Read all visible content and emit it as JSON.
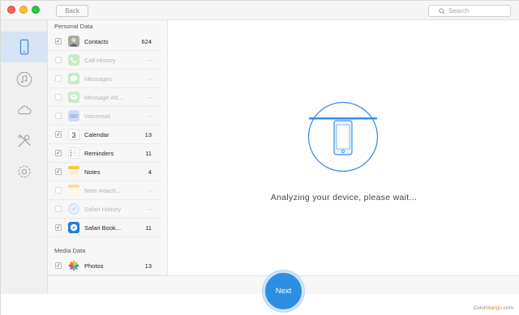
{
  "titlebar": {
    "back_label": "Back",
    "search_placeholder": "Search"
  },
  "sidebar": {
    "items": [
      {
        "icon": "phone-icon",
        "active": true
      },
      {
        "icon": "music-icon",
        "active": false
      },
      {
        "icon": "cloud-icon",
        "active": false
      },
      {
        "icon": "tools-icon",
        "active": false
      },
      {
        "icon": "gear-icon",
        "active": false
      }
    ]
  },
  "categories": {
    "personal_label": "Personal Data",
    "media_label": "Media Data",
    "items": [
      {
        "name": "Contacts",
        "count": "624",
        "checked": true,
        "enabled": true,
        "icon": "contacts-icon"
      },
      {
        "name": "Call History",
        "count": "--",
        "checked": false,
        "enabled": false,
        "icon": "phone-call-icon"
      },
      {
        "name": "Messages",
        "count": "--",
        "checked": false,
        "enabled": false,
        "icon": "messages-icon"
      },
      {
        "name": "Message Att...",
        "count": "--",
        "checked": false,
        "enabled": false,
        "icon": "message-attachment-icon"
      },
      {
        "name": "Voicemail",
        "count": "--",
        "checked": false,
        "enabled": false,
        "icon": "voicemail-icon"
      },
      {
        "name": "Calendar",
        "count": "13",
        "checked": true,
        "enabled": true,
        "icon": "calendar-icon"
      },
      {
        "name": "Reminders",
        "count": "11",
        "checked": true,
        "enabled": true,
        "icon": "reminders-icon"
      },
      {
        "name": "Notes",
        "count": "4",
        "checked": true,
        "enabled": true,
        "icon": "notes-icon"
      },
      {
        "name": "Note Attach...",
        "count": "--",
        "checked": false,
        "enabled": false,
        "icon": "note-attachment-icon"
      },
      {
        "name": "Safari History",
        "count": "--",
        "checked": false,
        "enabled": false,
        "icon": "safari-icon"
      },
      {
        "name": "Safari Book...",
        "count": "11",
        "checked": true,
        "enabled": true,
        "icon": "safari-bookmarks-icon"
      }
    ],
    "media_items": [
      {
        "name": "Photos",
        "count": "13",
        "checked": true,
        "enabled": true,
        "icon": "photos-icon"
      }
    ],
    "calendar_day": "3"
  },
  "main": {
    "status_text": "Analyzing your device, please wait..."
  },
  "footer": {
    "next_label": "Next",
    "watermark_prefix": "Color",
    "watermark_accent": "Mango",
    "watermark_suffix": ".com"
  },
  "colors": {
    "accent": "#2d8fe4",
    "sidebar_active": "#d6e4f5"
  }
}
